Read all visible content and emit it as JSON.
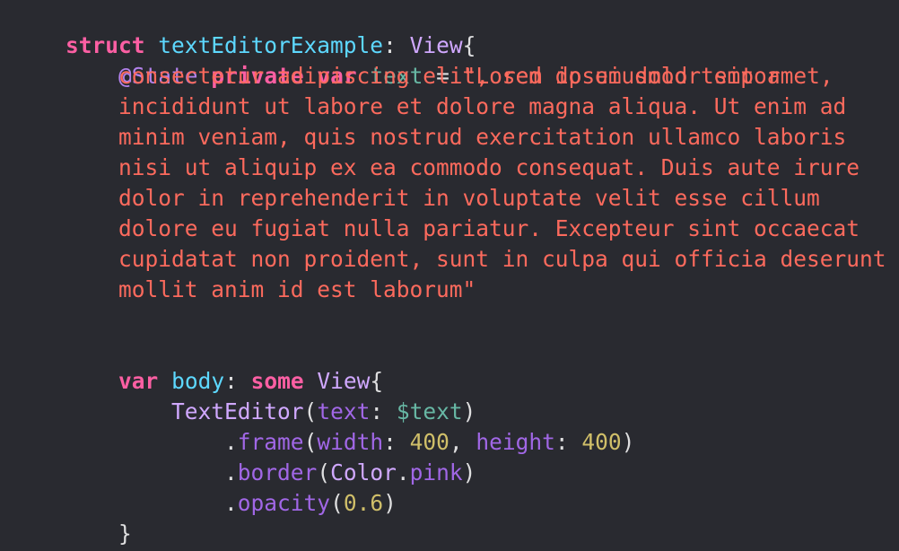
{
  "colors": {
    "background": "#292a30",
    "keyword": "#fc5fa3",
    "type_declaration": "#5dd8ff",
    "project_type": "#d0a8ff",
    "attribute": "#b281eb",
    "identifier": "#67b7a4",
    "string": "#fc6a5d",
    "number": "#d0bf69",
    "plain": "#dfdfe0",
    "property": "#a167e6"
  },
  "code": {
    "line1": {
      "kw_struct": "struct",
      "sp1": " ",
      "name": "textEditorExample",
      "colon": ": ",
      "type_view": "View",
      "brace": "{"
    },
    "line2": {
      "indent": "    ",
      "attr": "@State",
      "sp1": " ",
      "kw_private": "private",
      "sp2": " ",
      "kw_var": "var",
      "sp3": " ",
      "var_name": "text",
      "eq": " = ",
      "str": "\"Lorem ipsum dolor sit amet,"
    },
    "string_lines": [
      "consectetur adipiscing elit, sed do eiusmod tempor",
      "incididunt ut labore et dolore magna aliqua. Ut enim ad",
      "minim veniam, quis nostrud exercitation ullamco laboris",
      "nisi ut aliquip ex ea commodo consequat. Duis aute irure",
      "dolor in reprehenderit in voluptate velit esse cillum",
      "dolore eu fugiat nulla pariatur. Excepteur sint occaecat",
      "cupidatat non proident, sunt in culpa qui officia deserunt",
      "mollit anim id est laborum\""
    ],
    "string_indent": "        ",
    "line_body": {
      "indent": "    ",
      "kw_var": "var",
      "sp1": " ",
      "name": "body",
      "colon": ": ",
      "kw_some": "some",
      "sp2": " ",
      "type_view": "View",
      "brace": "{"
    },
    "line_texteditor": {
      "indent": "        ",
      "type": "TextEditor",
      "open": "(",
      "label": "text",
      "colon": ": ",
      "binding": "$text",
      "close": ")"
    },
    "line_frame": {
      "indent": "            ",
      "dot": ".",
      "method": "frame",
      "open": "(",
      "label_width": "width",
      "colon1": ": ",
      "width_value": "400",
      "comma": ", ",
      "label_height": "height",
      "colon2": ": ",
      "height_value": "400",
      "close": ")"
    },
    "line_border": {
      "indent": "            ",
      "dot": ".",
      "method": "border",
      "open": "(",
      "type_color": "Color",
      "dot2": ".",
      "member": "pink",
      "close": ")"
    },
    "line_opacity": {
      "indent": "            ",
      "dot": ".",
      "method": "opacity",
      "open": "(",
      "value": "0.6",
      "close": ")"
    },
    "line_close_body": {
      "indent": "    ",
      "brace": "}"
    },
    "line_close_struct": {
      "brace": "}"
    }
  }
}
